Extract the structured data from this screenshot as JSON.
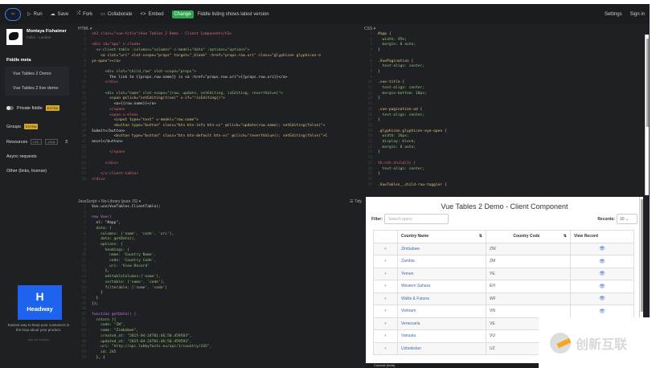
{
  "topbar": {
    "logo": "∞",
    "run": "Run",
    "save": "Save",
    "fork": "Fork",
    "collaborate": "Collaborate",
    "embed": "Embed",
    "badge": "Change",
    "status": "Fiddle listing shows latest version",
    "settings": "Settings",
    "signin": "Sign in"
  },
  "sidebar": {
    "user_name": "Montaya Fishaimer",
    "user_sub": "Fuller · London",
    "meta_title": "Fiddle meta",
    "items": [
      "Vue Tables 2 Demo",
      "Vue Tables 2 live demo"
    ],
    "private": "Private fiddle",
    "private_tag": "EXTRA",
    "groups": "Groups",
    "groups_tag": "EXTRA",
    "resources": "Resources",
    "res_tag1": "URL",
    "res_tag2": "cdnjs",
    "res_count": "3",
    "async": "Async requests",
    "other": "Other (links, license)",
    "ad": {
      "logo": "H",
      "brand": "Headway",
      "text": "Easiest way to keep your customers in the loop about your product.",
      "by": "ads via Carbon"
    }
  },
  "html_panel": {
    "label": "HTML ▾",
    "lines": [
      [
        "c-tag",
        "<h3 class=\"vue-title\">Vue Tables 2 Demo - Client Component</h3>"
      ],
      [
        "c-txt",
        ""
      ],
      [
        "c-tag",
        "<div id=\"app\" v-cloak>"
      ],
      [
        "c-att",
        "  <v-client-table :columns=\"columns\" v-model=\"data\" :options=\"options\">"
      ],
      [
        "c-str",
        "    <a slot=\"uri\" slot-scope=\"props\" target=\"_blank\" :href=\"props.row.uri\" class=\"glyphicon glyphicon-e"
      ],
      [
        "c-str",
        "ye-open\"></a>"
      ],
      [
        "c-txt",
        ""
      ],
      [
        "c-att",
        "      <div slot=\"child_row\" slot-scope=\"props\">"
      ],
      [
        "c-txt",
        "        The link to {{props.row.name}} is <a :href=\"props.row.uri\">{{props.row.uri}}</a>"
      ],
      [
        "c-tag",
        "      </div>"
      ],
      [
        "c-txt",
        ""
      ],
      [
        "c-att",
        "      <div slot=\"name\" slot-scope=\"{row, update, setEditing, isEditing, revertValue}\">"
      ],
      [
        "c-str",
        "        <span @click=\"setEditing(true)\" v-if=\"!isEditing()\">"
      ],
      [
        "c-txt",
        "          <a>{{row.name}}</a>"
      ],
      [
        "c-tag",
        "        </span>"
      ],
      [
        "c-tag",
        "        <span v-else>"
      ],
      [
        "c-str",
        "          <input type=\"text\" v-model=\"row.name\">"
      ],
      [
        "c-str",
        "          <button type=\"button\" class=\"btn btn-info btn-xs\" @click=\"update(row.name); setEditing(false)\">"
      ],
      [
        "c-txt",
        "Submit</button>"
      ],
      [
        "c-str",
        "          <button type=\"button\" class=\"btn btn-default btn-xs\" @click=\"revertValue(); setEditing(false)\">C"
      ],
      [
        "c-txt",
        "ancel</button>"
      ],
      [
        "c-txt",
        ""
      ],
      [
        "c-tag",
        "        </span>"
      ],
      [
        "c-txt",
        ""
      ],
      [
        "c-tag",
        "      </div>"
      ],
      [
        "c-txt",
        ""
      ],
      [
        "c-tag",
        "    </v-client-table>"
      ],
      [
        "c-tag",
        "</div>"
      ]
    ]
  },
  "css_panel": {
    "label": "CSS ▾",
    "lines": [
      [
        "c-str",
        "#app {"
      ],
      [
        "c-att",
        "  width: 95%;"
      ],
      [
        "c-att",
        "  margin: 0 auto;"
      ],
      [
        "c-txt",
        "}"
      ],
      [
        "c-txt",
        ""
      ],
      [
        "c-str",
        ".VuePagination {"
      ],
      [
        "c-att",
        "  text-align: center;"
      ],
      [
        "c-txt",
        "}"
      ],
      [
        "c-txt",
        ""
      ],
      [
        "c-str",
        ".vue-title {"
      ],
      [
        "c-att",
        "  text-align: center;"
      ],
      [
        "c-att",
        "  margin-bottom: 10px;"
      ],
      [
        "c-txt",
        "}"
      ],
      [
        "c-txt",
        ""
      ],
      [
        "c-str",
        ".vue-pagination-ad {"
      ],
      [
        "c-att",
        "  text-align: center;"
      ],
      [
        "c-txt",
        "}"
      ],
      [
        "c-txt",
        ""
      ],
      [
        "c-str",
        ".glyphicon.glyphicon-eye-open {"
      ],
      [
        "c-att",
        "  width: 16px;"
      ],
      [
        "c-att",
        "  display: block;"
      ],
      [
        "c-att",
        "  margin: 0 auto;"
      ],
      [
        "c-txt",
        "}"
      ],
      [
        "c-txt",
        ""
      ],
      [
        "c-tag",
        "th:nth-child(3) {"
      ],
      [
        "c-att",
        "  text-align: center;"
      ],
      [
        "c-txt",
        "}"
      ],
      [
        "c-txt",
        ""
      ],
      [
        "c-str",
        ".VueTables__child-row-toggler {"
      ]
    ]
  },
  "js_panel": {
    "label": "JavaScript + No-Library (pure JS) ▾",
    "tidy": "☰ Tidy",
    "lines": [
      [
        "c-txt",
        "Vue.use(VueTables.ClientTable);"
      ],
      [
        "c-txt",
        ""
      ],
      [
        "c-kw",
        "new Vue({"
      ],
      [
        "c-txt",
        "  el: \"#app\","
      ],
      [
        "c-att",
        "  data: {"
      ],
      [
        "c-att",
        "    columns: ['name', 'code', 'uri'],"
      ],
      [
        "c-att",
        "    data: getData(),"
      ],
      [
        "c-att",
        "    options: {"
      ],
      [
        "c-att",
        "      headings: {"
      ],
      [
        "c-att",
        "        name: 'Country Name',"
      ],
      [
        "c-att",
        "        code: 'Country Code',"
      ],
      [
        "c-att",
        "        uri: 'View Record'"
      ],
      [
        "c-txt",
        "      },"
      ],
      [
        "c-att",
        "      editableColumns:['name'],"
      ],
      [
        "c-att",
        "      sortable: ['name', 'code'],"
      ],
      [
        "c-att",
        "      filterable: ['name', 'code']"
      ],
      [
        "c-txt",
        "    }"
      ],
      [
        "c-txt",
        "  }"
      ],
      [
        "c-txt",
        "});"
      ],
      [
        "c-txt",
        ""
      ],
      [
        "c-kw",
        "function getData() {"
      ],
      [
        "c-att",
        "  return [{"
      ],
      [
        "c-att",
        "    code: \"ZW\","
      ],
      [
        "c-att",
        "    name: \"Zimbabwe\","
      ],
      [
        "c-att",
        "    created_at: \"2015-04-24T01:46:50.459583\","
      ],
      [
        "c-att",
        "    updated_at: \"2015-04-24T01:46:50.459593\","
      ],
      [
        "c-att",
        "    uri: \"http://api.lobbyfacts.eu/api/1/country/245\","
      ],
      [
        "c-att",
        "    id: 245"
      ],
      [
        "c-txt",
        "  }, {"
      ]
    ]
  },
  "result": {
    "title": "Vue Tables 2 Demo - Client Component",
    "filter_label": "Filter:",
    "filter_placeholder": "Search query",
    "records_label": "Records:",
    "records_value": "10",
    "headers": [
      "",
      "Country Name",
      "Country Code",
      "View Record"
    ],
    "rows": [
      [
        "Zimbabwe",
        "ZW"
      ],
      [
        "Zambia",
        "ZM"
      ],
      [
        "Yemen",
        "YE"
      ],
      [
        "Western Sahara",
        "EH"
      ],
      [
        "Wallis & Futuna",
        "WF"
      ],
      [
        "Vietnam",
        "VN"
      ],
      [
        "Venezuela",
        "VE"
      ],
      [
        "Vanuatu",
        "VU"
      ],
      [
        "Uzbekistan",
        "UZ"
      ]
    ],
    "console": "Console (beta)"
  },
  "watermark": "创新互联"
}
